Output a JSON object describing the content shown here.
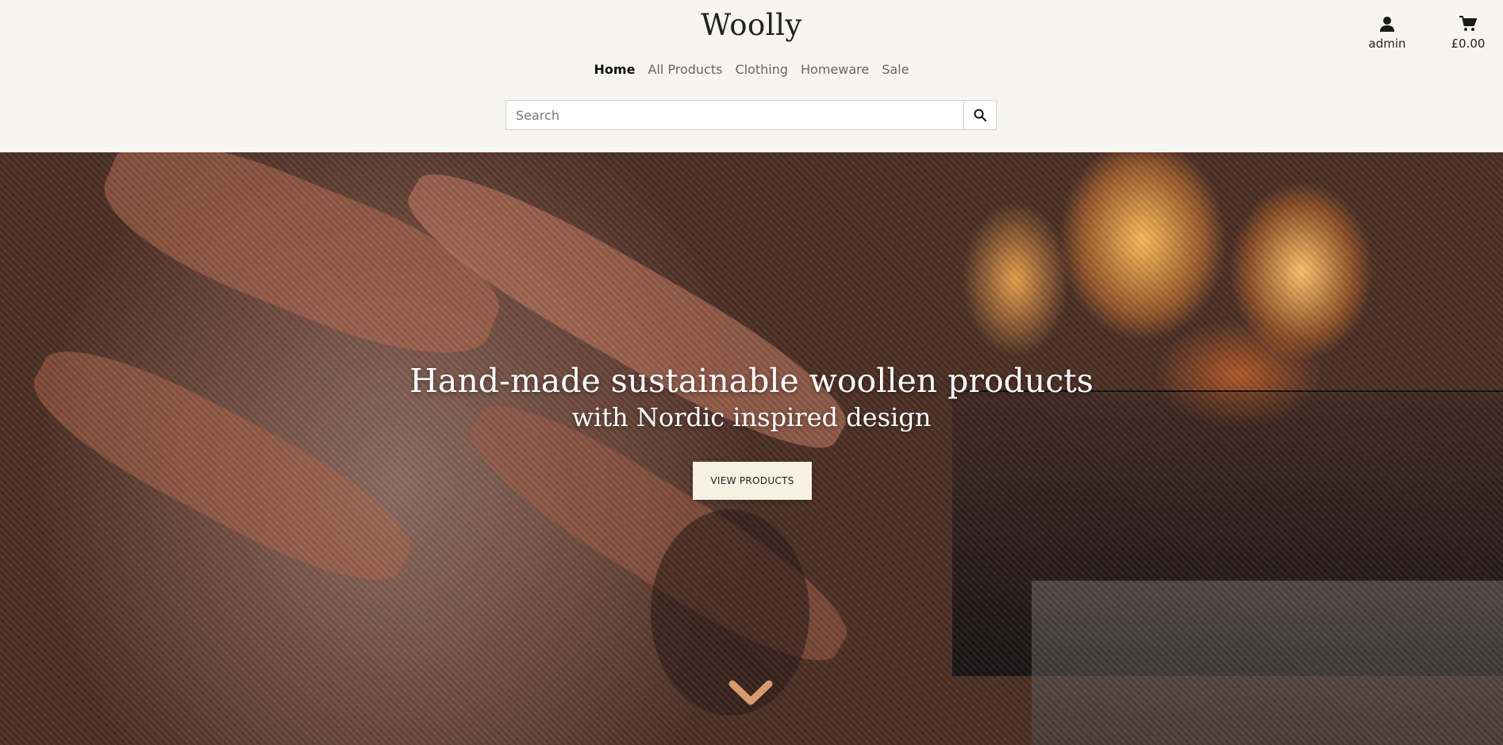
{
  "brand": "Woolly",
  "nav": {
    "items": [
      {
        "label": "Home",
        "active": true
      },
      {
        "label": "All Products",
        "active": false
      },
      {
        "label": "Clothing",
        "active": false
      },
      {
        "label": "Homeware",
        "active": false
      },
      {
        "label": "Sale",
        "active": false
      }
    ]
  },
  "search": {
    "placeholder": "Search",
    "value": "",
    "icon": "search-icon"
  },
  "account": {
    "label": "admin",
    "icon": "user-icon"
  },
  "cart": {
    "total": "£0.00",
    "icon": "cart-icon"
  },
  "hero": {
    "title": "Hand-made sustainable woollen products",
    "subtitle": "with Nordic inspired design",
    "cta_label": "VIEW PRODUCTS",
    "scroll_icon": "chevron-down-icon"
  },
  "colors": {
    "background": "#f7f5f1",
    "cta_background": "#f6f1e3",
    "chevron": "#d99a6c"
  }
}
